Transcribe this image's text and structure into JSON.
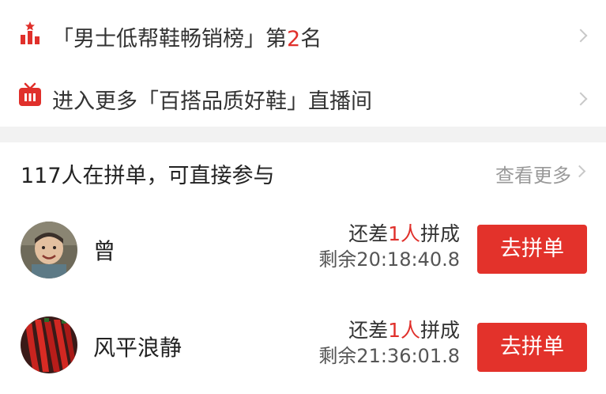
{
  "rank_line": {
    "prefix": "「男士低帮鞋畅销榜」第",
    "rank_number": "2",
    "suffix": "名",
    "icon": "ranking-bars-icon"
  },
  "live_line": {
    "text": "进入更多「百搭品质好鞋」直播间",
    "icon": "tv-live-icon"
  },
  "group_buy": {
    "title": "117人在拼单，可直接参与",
    "more_label": "查看更多",
    "items": [
      {
        "avatar": "child-avatar",
        "name": "曾",
        "need_prefix": "还差",
        "need_count": "1人",
        "need_suffix": "拼成",
        "remaining": "剩余20:18:40.8",
        "button_label": "去拼单"
      },
      {
        "avatar": "red-peppers-avatar",
        "name": "风平浪静",
        "need_prefix": "还差",
        "need_count": "1人",
        "need_suffix": "拼成",
        "remaining": "剩余21:36:01.8",
        "button_label": "去拼单"
      }
    ]
  },
  "colors": {
    "accent_red": "#e3322b",
    "divider_gray": "#f2f2f2",
    "muted_text": "#999999"
  }
}
